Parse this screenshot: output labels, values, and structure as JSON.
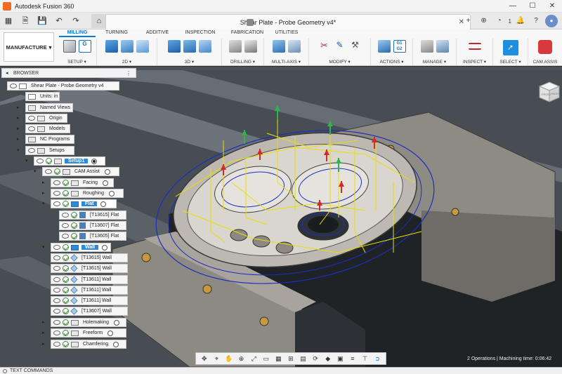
{
  "titlebar": {
    "app_title": "Autodesk Fusion 360",
    "minimize": "—",
    "maximize": "☐",
    "close": "✕"
  },
  "document": {
    "title": "Shear Plate - Probe Geometry v4*",
    "close": "✕"
  },
  "tabbar_right": {
    "add": "+",
    "badge_count": "1"
  },
  "ribbon": {
    "workspace": "MANUFACTURE",
    "tabs": [
      "MILLING",
      "TURNING",
      "ADDITIVE",
      "INSPECTION",
      "FABRICATION",
      "UTILITIES"
    ],
    "groups": [
      "SETUP ▾",
      "2D ▾",
      "3D ▾",
      "DRILLING ▾",
      "MULTI-AXIS ▾",
      "MODIFY ▾",
      "ACTIONS ▾",
      "MANAGE ▾",
      "INSPECT ▾",
      "SELECT ▾",
      "CAM ASSIS"
    ]
  },
  "browser": {
    "title": "BROWSER",
    "items": [
      {
        "label": "Shear Plate - Probe Geometry v4"
      },
      {
        "label": "Units: in"
      },
      {
        "label": "Named Views"
      },
      {
        "label": "Origin"
      },
      {
        "label": "Models"
      },
      {
        "label": "NC Programs"
      },
      {
        "label": "Setups"
      },
      {
        "label": "Setup1"
      },
      {
        "label": "CAM Assist"
      },
      {
        "label": "Facing"
      },
      {
        "label": "Roughing"
      },
      {
        "label": "Flat"
      },
      {
        "label": "[T13615] Flat"
      },
      {
        "label": "[T13607] Flat"
      },
      {
        "label": "[T13605] Flat"
      },
      {
        "label": "Wall"
      },
      {
        "label": "[T13615] Wall"
      },
      {
        "label": "[T13615] Wall"
      },
      {
        "label": "[T13611] Wall"
      },
      {
        "label": "[T13611] Wall"
      },
      {
        "label": "[T13611] Wall"
      },
      {
        "label": "[T13607] Wall"
      },
      {
        "label": "Holemaking"
      },
      {
        "label": "Freeform"
      },
      {
        "label": "Chamfering"
      }
    ]
  },
  "viewcube": {
    "front": "FRONT",
    "right": "RIGHT"
  },
  "status": {
    "text": "2 Operations | Machining time: 0:06:42"
  },
  "text_commands": {
    "label": "TEXT COMMANDS"
  },
  "colors": {
    "accent": "#0a7bd6",
    "selection": "#2c8ad8",
    "toolpath_blue": "#1b2fbf",
    "toolpath_yellow": "#e8e000",
    "app_brand": "#f26b21"
  }
}
